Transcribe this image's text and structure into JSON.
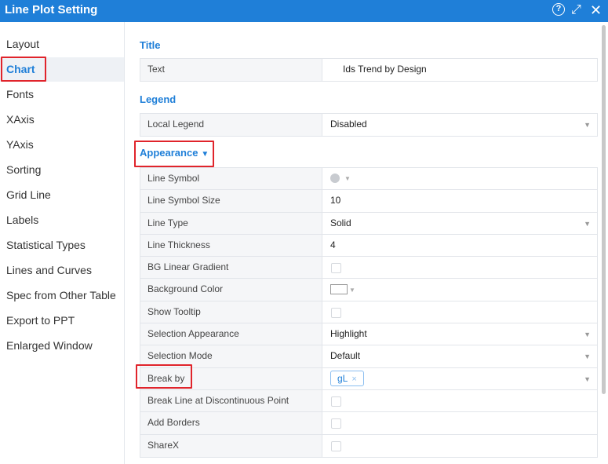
{
  "window": {
    "title": "Line Plot Setting",
    "help_glyph": "?",
    "expand_glyph": "⤢",
    "close_glyph": "✕"
  },
  "sidebar": {
    "items": [
      {
        "label": "Layout"
      },
      {
        "label": "Chart"
      },
      {
        "label": "Fonts"
      },
      {
        "label": "XAxis"
      },
      {
        "label": "YAxis"
      },
      {
        "label": "Sorting"
      },
      {
        "label": "Grid Line"
      },
      {
        "label": "Labels"
      },
      {
        "label": "Statistical Types"
      },
      {
        "label": "Lines and Curves"
      },
      {
        "label": "Spec from Other Table"
      },
      {
        "label": "Export to PPT"
      },
      {
        "label": "Enlarged Window"
      }
    ],
    "selected": "Chart"
  },
  "sections": {
    "title": {
      "heading": "Title",
      "rows": [
        {
          "label": "Text",
          "value": "Ids Trend by Design"
        }
      ]
    },
    "legend": {
      "heading": "Legend",
      "rows": [
        {
          "label": "Local Legend",
          "value": "Disabled"
        }
      ]
    },
    "appearance": {
      "heading": "Appearance",
      "rows": [
        {
          "label": "Line Symbol"
        },
        {
          "label": "Line Symbol Size",
          "value": "10"
        },
        {
          "label": "Line Type",
          "value": "Solid"
        },
        {
          "label": "Line Thickness",
          "value": "4"
        },
        {
          "label": "BG Linear Gradient"
        },
        {
          "label": "Background Color"
        },
        {
          "label": "Show Tooltip"
        },
        {
          "label": "Selection Appearance",
          "value": "Highlight"
        },
        {
          "label": "Selection Mode",
          "value": "Default"
        },
        {
          "label": "Break by",
          "tag": "gL"
        },
        {
          "label": "Break Line at Discontinuous Point"
        },
        {
          "label": "Add Borders"
        },
        {
          "label": "ShareX"
        }
      ]
    }
  },
  "icons": {
    "dropdown": "▼",
    "tag_remove": "×"
  },
  "colors": {
    "accent": "#1f7fd8",
    "highlight_box": "#e0242b"
  }
}
